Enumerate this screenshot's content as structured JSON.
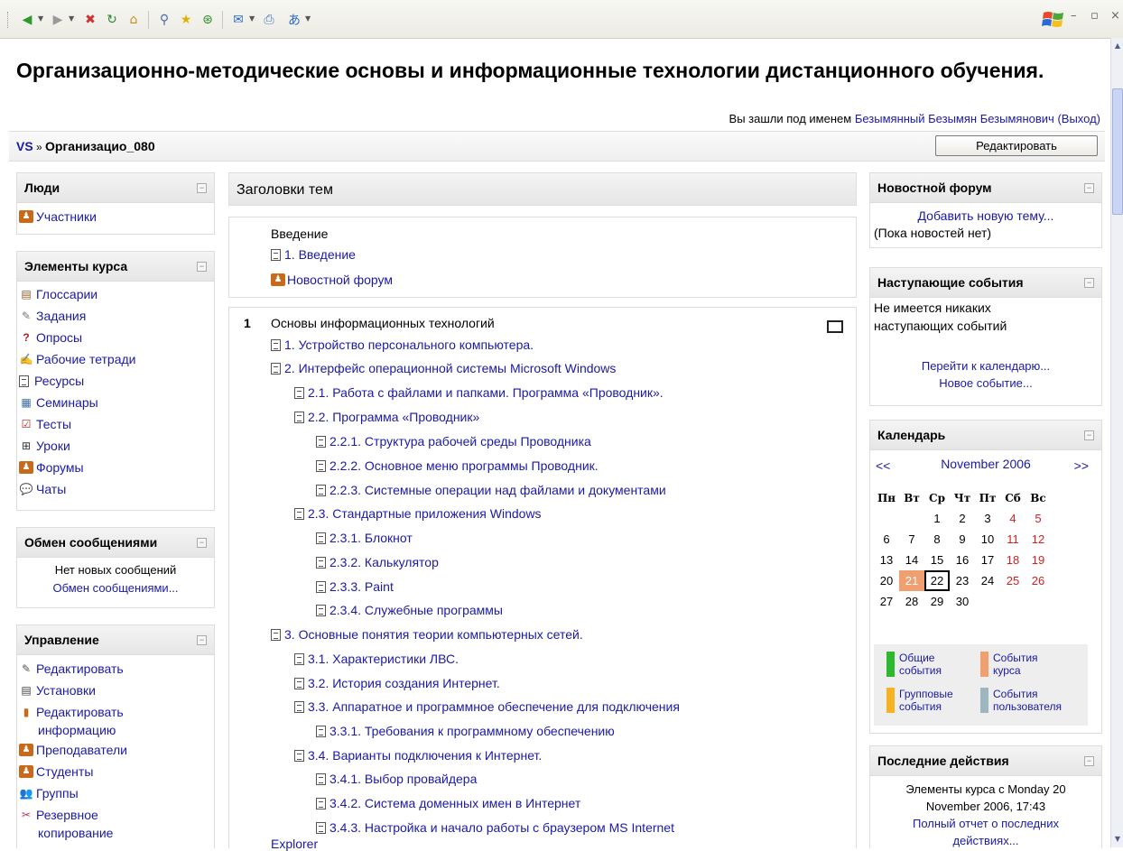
{
  "window": {
    "controls": [
      "–",
      "▫",
      "×"
    ]
  },
  "page": {
    "title": "Организационно-методические основы и информационные технологии дистанционного обучения.",
    "login_prefix": "Вы зашли под именем ",
    "user_name": "Безымянный Безымян Безымянович",
    "logout": "(Выход)",
    "breadcrumb_root": "VS",
    "breadcrumb_sep": " » ",
    "breadcrumb_course": "Организацио_080",
    "edit_button": "Редактировать"
  },
  "left": {
    "people": {
      "title": "Люди",
      "items": [
        "Участники"
      ]
    },
    "elements": {
      "title": "Элементы курса",
      "items": [
        "Глоссарии",
        "Задания",
        "Опросы",
        "Рабочие тетради",
        "Ресурсы",
        "Семинары",
        "Тесты",
        "Уроки",
        "Форумы",
        "Чаты"
      ]
    },
    "messages": {
      "title": "Обмен сообщениями",
      "status": "Нет новых сообщений",
      "link": "Обмен сообщениями..."
    },
    "admin": {
      "title": "Управление",
      "items": [
        "Редактировать",
        "Установки",
        "Редактировать",
        "информацию",
        "Преподаватели",
        "Студенты",
        "Группы",
        "Резервное",
        "копирование"
      ]
    }
  },
  "center": {
    "heading": "Заголовки тем",
    "intro": {
      "title": "Введение",
      "items": [
        "1. Введение",
        "Новостной форум"
      ]
    },
    "section1": {
      "number": "1",
      "title": "Основы информационных технологий",
      "items": [
        "1. Устройство персонального компьютера.",
        "2. Интерфейс операционной системы Microsoft Windows",
        "2.1. Работа с файлами и папками. Программа «Проводник».",
        "2.2. Программа «Проводник»",
        "2.2.1. Структура рабочей среды Проводника",
        "2.2.2. Основное меню программы Проводник.",
        "2.2.3. Системные операции над файлами и документами",
        "2.3. Стандартные приложения Windows",
        "2.3.1. Блокнот",
        "2.3.2. Калькулятор",
        "2.3.3. Paint",
        "2.3.4. Служебные программы",
        "3. Основные понятия теории компьютерных сетей.",
        "3.1. Характеристики  ЛВС.",
        "3.2. История создания Интернет.",
        "3.3. Аппаратное и программное обеспечение для подключения",
        "3.3.1. Требования к программному обеспечению",
        "3.4. Варианты подключения к Интернет.",
        "3.4.1. Выбор провайдера",
        "3.4.2. Система доменных имен в Интернет",
        "3.4.3.  Настройка и начало работы с браузером MS Internet",
        "Explorer"
      ]
    }
  },
  "right": {
    "news": {
      "title": "Новостной форум",
      "link": "Добавить новую тему...",
      "status": "(Пока новостей нет)"
    },
    "events": {
      "title": "Наступающие события",
      "line1": "Не имеется никаких",
      "line2": "наступающих событий",
      "link1": "Перейти к календарю...",
      "link2": "Новое событие..."
    },
    "calendar": {
      "title": "Календарь",
      "prev": "<<",
      "month": "November 2006",
      "next": ">>",
      "weekdays": [
        "Пн",
        "Вт",
        "Ср",
        "Чт",
        "Пт",
        "Сб",
        "Вс"
      ],
      "weeks": [
        [
          "",
          "",
          "1",
          "2",
          "3",
          "4",
          "5"
        ],
        [
          "6",
          "7",
          "8",
          "9",
          "10",
          "11",
          "12"
        ],
        [
          "13",
          "14",
          "15",
          "16",
          "17",
          "18",
          "19"
        ],
        [
          "20",
          "21",
          "22",
          "23",
          "24",
          "25",
          "26"
        ],
        [
          "27",
          "28",
          "29",
          "30",
          "",
          "",
          ""
        ]
      ],
      "highlight_day": "21",
      "today": "22",
      "highlight_color": "#f0a070",
      "legend": [
        {
          "line1": "Общие",
          "line2": "события",
          "color": "#2eb82e"
        },
        {
          "line1": "События",
          "line2": "курса",
          "color": "#f0a070"
        },
        {
          "line1": "Групповые",
          "line2": "события",
          "color": "#f5b324"
        },
        {
          "line1": "События",
          "line2": "пользователя",
          "color": "#9fb5c0"
        }
      ]
    },
    "recent": {
      "title": "Последние действия",
      "line1": "Элементы курса с Monday 20",
      "line2": "November 2006, 17:43",
      "link1": "Полный отчет о последних",
      "link2": "действиях..."
    }
  }
}
